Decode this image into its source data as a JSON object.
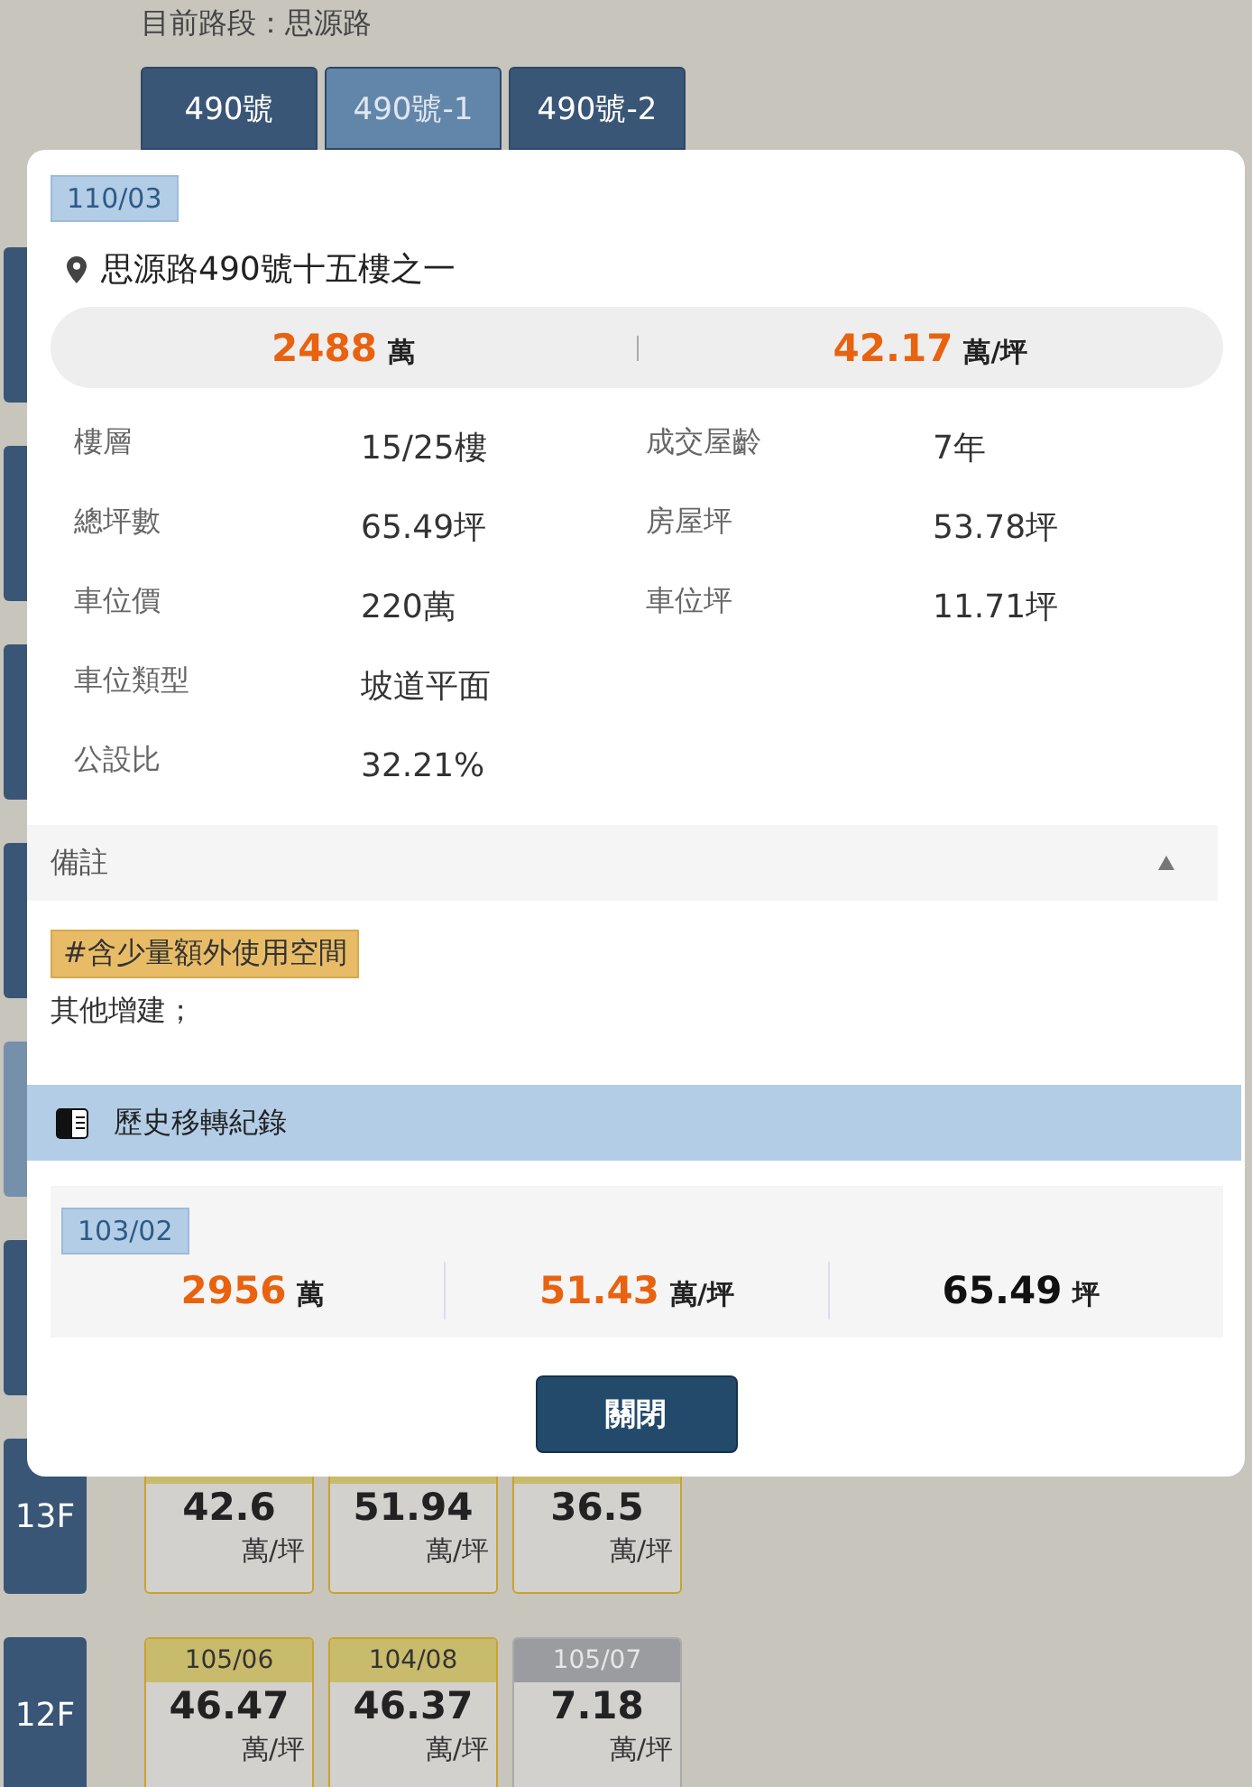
{
  "road_segment": "目前路段：思源路",
  "tabs": [
    {
      "label": "490號",
      "selected": false
    },
    {
      "label": "490號-1",
      "selected": true
    },
    {
      "label": "490號-2",
      "selected": false
    }
  ],
  "floors": [
    {
      "selected": false
    },
    {
      "selected": false
    },
    {
      "selected": false
    },
    {
      "selected": false
    },
    {
      "selected": true
    },
    {
      "selected": false
    },
    {
      "label": "13F",
      "selected": false,
      "units": [
        {
          "price": "42.6",
          "unit": "萬/坪",
          "kind": "normal"
        },
        {
          "price": "51.94",
          "unit": "萬/坪",
          "kind": "normal"
        },
        {
          "price": "36.5",
          "unit": "萬/坪",
          "kind": "normal"
        }
      ]
    },
    {
      "label": "12F",
      "selected": false,
      "units": [
        {
          "date": "105/06",
          "price": "46.47",
          "unit": "萬/坪",
          "kind": "normal"
        },
        {
          "date": "104/08",
          "price": "46.37",
          "unit": "萬/坪",
          "kind": "normal"
        },
        {
          "date": "105/07",
          "price": "7.18",
          "unit": "萬/坪",
          "kind": "special"
        }
      ]
    }
  ],
  "dialog": {
    "date": "110/03",
    "address": "思源路490號十五樓之一",
    "total_price": {
      "value": "2488",
      "unit": "萬"
    },
    "unit_price": {
      "value": "42.17",
      "unit": "萬/坪"
    },
    "details": [
      [
        {
          "label": "樓層",
          "value": "15/25樓"
        },
        {
          "label": "成交屋齡",
          "value": "7年"
        }
      ],
      [
        {
          "label": "總坪數",
          "value": "65.49坪"
        },
        {
          "label": "房屋坪",
          "value": "53.78坪"
        }
      ],
      [
        {
          "label": "車位價",
          "value": "220萬"
        },
        {
          "label": "車位坪",
          "value": "11.71坪"
        }
      ],
      [
        {
          "label": "車位類型",
          "value": "坡道平面"
        }
      ],
      [
        {
          "label": "公設比",
          "value": "32.21%"
        }
      ]
    ],
    "remarks": {
      "title": "備註",
      "expanded": true,
      "tags": [
        "#含少量額外使用空間"
      ],
      "text": "其他增建；"
    },
    "history": {
      "title": "歷史移轉紀錄",
      "records": [
        {
          "date": "103/02",
          "cells": [
            {
              "value": "2956",
              "unit": "萬",
              "kind": "price"
            },
            {
              "value": "51.43",
              "unit": "萬/坪",
              "kind": "price"
            },
            {
              "value": "65.49",
              "unit": "坪",
              "kind": "area"
            }
          ]
        }
      ]
    },
    "close_button": "關閉"
  }
}
